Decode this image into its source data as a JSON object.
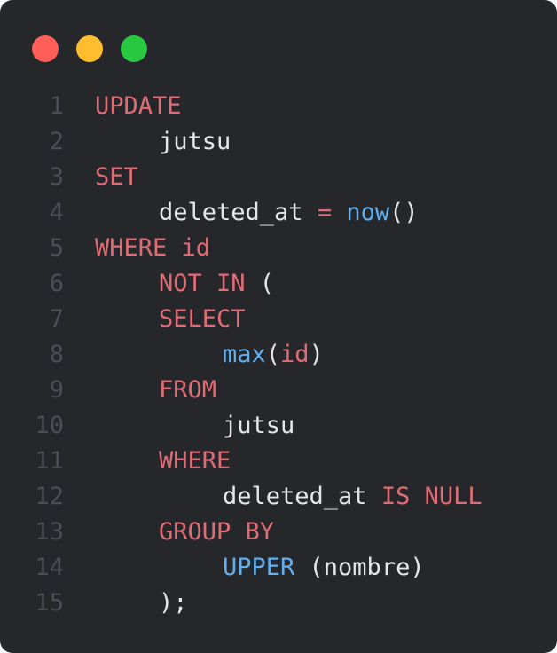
{
  "window": {
    "controls": [
      {
        "name": "close-dot",
        "color": "#ff5f57"
      },
      {
        "name": "minimize-dot",
        "color": "#febc2e"
      },
      {
        "name": "maximize-dot",
        "color": "#28c840"
      }
    ]
  },
  "theme": {
    "keyword": "#e06c75",
    "function": "#61afef",
    "text": "#e6e6e6",
    "line_number": "#4a4e56"
  },
  "code": {
    "language": "sql",
    "lines": [
      {
        "number": "1",
        "indent": 0,
        "tokens": [
          {
            "t": "UPDATE",
            "k": "keyword"
          }
        ]
      },
      {
        "number": "2",
        "indent": 1,
        "tokens": [
          {
            "t": "jutsu",
            "k": "text"
          }
        ]
      },
      {
        "number": "3",
        "indent": 0,
        "tokens": [
          {
            "t": "SET",
            "k": "keyword"
          }
        ]
      },
      {
        "number": "4",
        "indent": 1,
        "tokens": [
          {
            "t": "deleted_at",
            "k": "text"
          },
          {
            "t": " = ",
            "k": "keyword"
          },
          {
            "t": "now",
            "k": "function"
          },
          {
            "t": "()",
            "k": "text"
          }
        ]
      },
      {
        "number": "5",
        "indent": 0,
        "tokens": [
          {
            "t": "WHERE id",
            "k": "keyword"
          }
        ]
      },
      {
        "number": "6",
        "indent": 1,
        "tokens": [
          {
            "t": "NOT IN",
            "k": "keyword"
          },
          {
            "t": " (",
            "k": "text"
          }
        ]
      },
      {
        "number": "7",
        "indent": 1,
        "tokens": [
          {
            "t": "SELECT",
            "k": "keyword"
          }
        ]
      },
      {
        "number": "8",
        "indent": 2,
        "tokens": [
          {
            "t": "max",
            "k": "function"
          },
          {
            "t": "(",
            "k": "text"
          },
          {
            "t": "id",
            "k": "keyword"
          },
          {
            "t": ")",
            "k": "text"
          }
        ]
      },
      {
        "number": "9",
        "indent": 1,
        "tokens": [
          {
            "t": "FROM",
            "k": "keyword"
          }
        ]
      },
      {
        "number": "10",
        "indent": 2,
        "tokens": [
          {
            "t": "jutsu",
            "k": "text"
          }
        ]
      },
      {
        "number": "11",
        "indent": 1,
        "tokens": [
          {
            "t": "WHERE",
            "k": "keyword"
          }
        ]
      },
      {
        "number": "12",
        "indent": 2,
        "tokens": [
          {
            "t": "deleted_at ",
            "k": "text"
          },
          {
            "t": "IS NULL",
            "k": "keyword"
          }
        ]
      },
      {
        "number": "13",
        "indent": 1,
        "tokens": [
          {
            "t": "GROUP BY",
            "k": "keyword"
          }
        ]
      },
      {
        "number": "14",
        "indent": 2,
        "tokens": [
          {
            "t": "UPPER",
            "k": "function"
          },
          {
            "t": " (nombre)",
            "k": "text"
          }
        ]
      },
      {
        "number": "15",
        "indent": 1,
        "tokens": [
          {
            "t": ");",
            "k": "text"
          }
        ]
      }
    ]
  }
}
